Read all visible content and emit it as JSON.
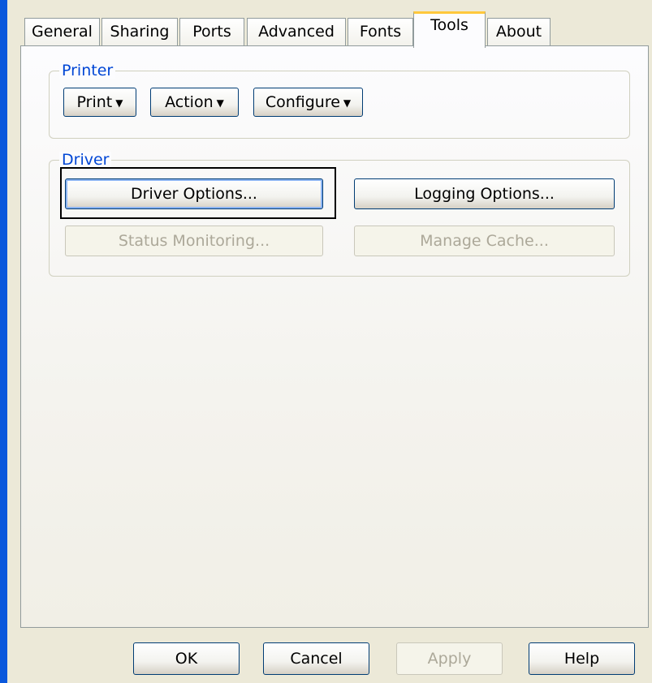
{
  "tabs": [
    {
      "label": "General"
    },
    {
      "label": "Sharing"
    },
    {
      "label": "Ports"
    },
    {
      "label": "Advanced"
    },
    {
      "label": "Fonts"
    },
    {
      "label": "Tools"
    },
    {
      "label": "About"
    }
  ],
  "active_tab": "Tools",
  "printer_group": {
    "title": "Printer",
    "print_label": "Print",
    "action_label": "Action",
    "configure_label": "Configure",
    "dropdown_arrow": "▼"
  },
  "driver_group": {
    "title": "Driver",
    "driver_options_label": "Driver Options...",
    "logging_options_label": "Logging Options...",
    "status_monitoring_label": "Status Monitoring...",
    "manage_cache_label": "Manage Cache..."
  },
  "footer": {
    "ok_label": "OK",
    "cancel_label": "Cancel",
    "apply_label": "Apply",
    "help_label": "Help"
  },
  "colors": {
    "group_title": "#0046D5",
    "active_tab_accent": "#FFC83C",
    "button_border": "#003C74",
    "disabled_text": "#ACA899",
    "window_edge": "#0A58DC"
  }
}
